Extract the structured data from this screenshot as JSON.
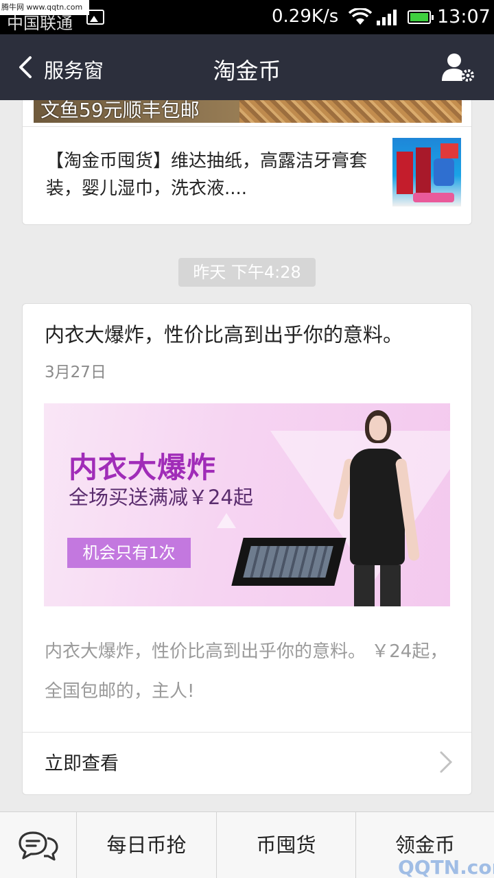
{
  "status_bar": {
    "watermark": "腾牛网 www.qqtn.com",
    "carrier": "中国联通",
    "net_speed": "0.29K/s",
    "time": "13:07",
    "icons": [
      "image-icon",
      "wifi-icon",
      "signal-icon",
      "battery-icon"
    ]
  },
  "nav": {
    "back_label": "服务窗",
    "title": "淘金币",
    "icons": [
      "back-chevron-icon",
      "person-settings-icon"
    ]
  },
  "card1": {
    "banner_text": "文鱼59元顺丰包邮",
    "item_text": "【淘金币囤货】维达抽纸，高露洁牙膏套装，婴儿湿巾，洗衣液...."
  },
  "timestamp": "昨天 下午4:28",
  "card2": {
    "headline": "内衣大爆炸，性价比高到出乎你的意料。",
    "date": "3月27日",
    "promo": {
      "title": "内衣大爆炸",
      "subtitle": "全场买送满减￥24起",
      "badge": "机会只有1次"
    },
    "summary": "内衣大爆炸，性价比高到出乎你的意料。 ￥24起，全国包邮的，主人!",
    "read_more": "立即查看"
  },
  "bottom_menu": {
    "items": [
      "每日币抢",
      "币囤货",
      "领金币"
    ],
    "icons": [
      "keyboard-chat-icon"
    ],
    "watermark": "QQTN.com 腾牛网"
  }
}
